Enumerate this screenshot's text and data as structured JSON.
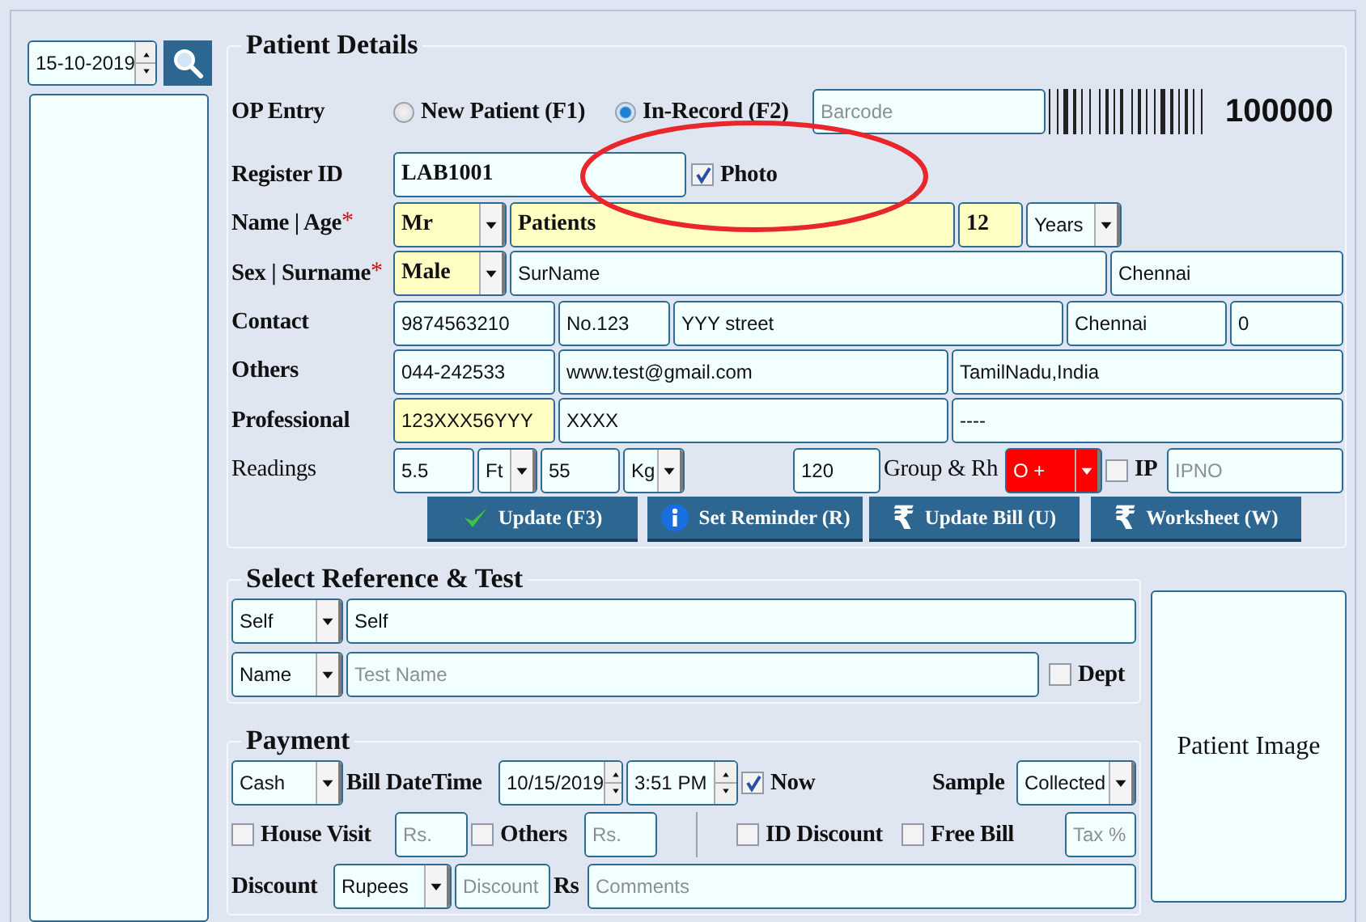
{
  "left_panel": {
    "date": "15-10-2019"
  },
  "annotation": {
    "visible": true
  },
  "patient_details": {
    "title": "Patient Details",
    "rows": [
      {
        "items": [
          {
            "kind": "label",
            "text": "OP Entry",
            "bold": true
          },
          {
            "kind": "radio",
            "label": "New Patient (F1)",
            "selected": false
          },
          {
            "kind": "radio",
            "label": "In-Record (F2)",
            "selected": true
          },
          {
            "kind": "field",
            "placeholder": "Barcode"
          },
          {
            "kind": "barcode"
          },
          {
            "kind": "number",
            "text": "100000"
          }
        ]
      },
      {
        "items": [
          {
            "kind": "label",
            "text": "Register ID",
            "bold": true
          },
          {
            "kind": "field",
            "value": "LAB1001",
            "bold": true
          },
          {
            "kind": "checkbox",
            "label": "Photo",
            "checked": true
          }
        ]
      },
      {
        "items": [
          {
            "kind": "label",
            "text": "Name | Age",
            "bold": true,
            "mark": "*"
          },
          {
            "kind": "combo",
            "value": "Mr",
            "bold": true,
            "highlighted": true
          },
          {
            "kind": "field",
            "value": "Patients",
            "bold": true,
            "highlighted": true
          },
          {
            "kind": "field",
            "value": "12",
            "bold": true,
            "highlighted": true
          },
          {
            "kind": "combo",
            "value": "Years"
          }
        ]
      },
      {
        "items": [
          {
            "kind": "label",
            "text": "Sex | Surname",
            "bold": true,
            "mark": "*"
          },
          {
            "kind": "combo",
            "value": "Male",
            "bold": true,
            "highlighted": true
          },
          {
            "kind": "field",
            "value": "SurName"
          },
          {
            "kind": "field",
            "value": "Chennai"
          }
        ]
      },
      {
        "items": [
          {
            "kind": "label",
            "text": "Contact",
            "bold": true
          },
          {
            "kind": "field",
            "value": "9874563210"
          },
          {
            "kind": "field",
            "value": "No.123"
          },
          {
            "kind": "field",
            "value": "YYY street"
          },
          {
            "kind": "field",
            "value": "Chennai"
          },
          {
            "kind": "field",
            "value": "0"
          }
        ]
      },
      {
        "items": [
          {
            "kind": "label",
            "text": "Others",
            "bold": true
          },
          {
            "kind": "field",
            "value": "044-242533"
          },
          {
            "kind": "field",
            "value": "www.test@gmail.com"
          },
          {
            "kind": "field",
            "value": "TamilNadu,India"
          }
        ]
      },
      {
        "items": [
          {
            "kind": "label",
            "text": "Professional",
            "bold": true
          },
          {
            "kind": "field",
            "value": "123XXX56YYY",
            "highlighted": true
          },
          {
            "kind": "field",
            "value": "XXXX"
          },
          {
            "kind": "field",
            "value": "----"
          }
        ]
      },
      {
        "items": [
          {
            "kind": "label",
            "text": "Readings",
            "bold": false
          },
          {
            "kind": "field",
            "value": "5.5"
          },
          {
            "kind": "combo",
            "value": "Ft"
          },
          {
            "kind": "field",
            "value": "55"
          },
          {
            "kind": "combo",
            "value": "Kg"
          },
          {
            "kind": "field",
            "value": "120"
          },
          {
            "kind": "label",
            "text": "Group & Rh",
            "bold": false
          },
          {
            "kind": "combo",
            "value": "O +",
            "alert": true
          },
          {
            "kind": "checkbox",
            "label": "IP",
            "checked": false
          },
          {
            "kind": "field",
            "placeholder": "IPNO"
          }
        ]
      },
      {
        "items": [
          {
            "kind": "button",
            "label": "Update (F3)"
          },
          {
            "kind": "button",
            "label": "Set Reminder (R)"
          },
          {
            "kind": "button",
            "label": "Update Bill (U)",
            "symbol": "₹"
          },
          {
            "kind": "button",
            "label": "Worksheet (W)",
            "symbol": "₹"
          }
        ]
      }
    ]
  },
  "reference_test": {
    "title": "Select Reference & Test",
    "rows": [
      {
        "items": [
          {
            "kind": "combo",
            "value": "Self"
          },
          {
            "kind": "field",
            "value": "Self"
          }
        ]
      },
      {
        "items": [
          {
            "kind": "combo",
            "value": "Name"
          },
          {
            "kind": "field",
            "placeholder": "Test Name"
          },
          {
            "kind": "checkbox",
            "label": "Dept",
            "checked": false
          }
        ]
      }
    ]
  },
  "payment": {
    "title": "Payment",
    "rows": [
      {
        "items": [
          {
            "kind": "combo",
            "value": "Cash"
          },
          {
            "kind": "label",
            "text": "Bill DateTime",
            "bold": true
          },
          {
            "kind": "spinner",
            "value": "10/15/2019"
          },
          {
            "kind": "spinner",
            "value": "3:51 PM"
          },
          {
            "kind": "checkbox",
            "label": "Now",
            "checked": true
          },
          {
            "kind": "label",
            "text": "Sample",
            "bold": true
          },
          {
            "kind": "combo",
            "value": "Collected"
          }
        ]
      },
      {
        "items": [
          {
            "kind": "checkbox",
            "label": "House Visit",
            "checked": false
          },
          {
            "kind": "field",
            "placeholder": "Rs."
          },
          {
            "kind": "checkbox",
            "label": "Others",
            "checked": false
          },
          {
            "kind": "field",
            "placeholder": "Rs."
          },
          {
            "kind": "checkbox",
            "label": "ID Discount",
            "checked": false
          },
          {
            "kind": "checkbox",
            "label": "Free Bill",
            "checked": false
          },
          {
            "kind": "field",
            "placeholder": "Tax %"
          }
        ]
      },
      {
        "items": [
          {
            "kind": "label",
            "text": "Discount",
            "bold": true
          },
          {
            "kind": "combo",
            "value": "Rupees"
          },
          {
            "kind": "field",
            "placeholder": "Discount"
          },
          {
            "kind": "label",
            "text": "Rs",
            "bold": true
          },
          {
            "kind": "field",
            "placeholder": "Comments"
          }
        ]
      }
    ]
  },
  "image_panel": {
    "text": "Patient Image"
  }
}
